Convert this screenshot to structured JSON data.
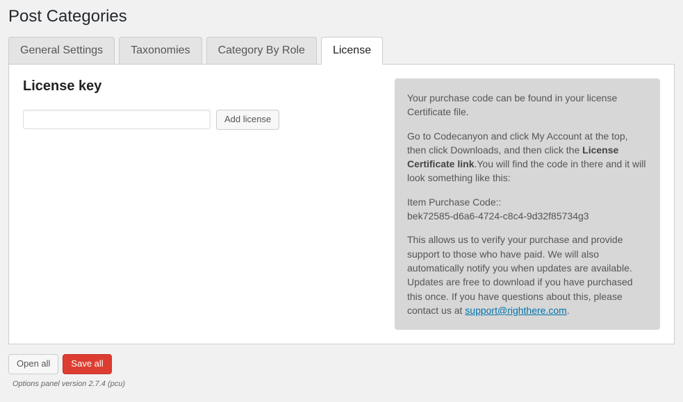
{
  "page": {
    "title": "Post Categories"
  },
  "tabs": [
    {
      "label": "General Settings",
      "active": false
    },
    {
      "label": "Taxonomies",
      "active": false
    },
    {
      "label": "Category By Role",
      "active": false
    },
    {
      "label": "License",
      "active": true
    }
  ],
  "license": {
    "section_title": "License key",
    "input_value": "",
    "add_button": "Add license"
  },
  "info": {
    "p1": "Your purchase code can be found in your license Certificate file.",
    "p2_a": "Go to Codecanyon and click My Account at the top, then click Downloads, and then click the ",
    "p2_strong": "License Certificate link",
    "p2_b": ".You will find the code in there and it will look something like this:",
    "p3_label": "Item Purchase Code::",
    "p3_code": "bek72585-d6a6-4724-c8c4-9d32f85734g3",
    "p4_a": "This allows us to verify your purchase and provide support to those who have paid. We will also automatically notify you when updates are available. Updates are free to download if you have purchased this once. If you have questions about this, please contact us at ",
    "p4_link": "support@righthere.com",
    "p4_b": "."
  },
  "footer": {
    "open_all": "Open all",
    "save_all": "Save all",
    "version": "Options panel version 2.7.4 (pcu)"
  }
}
